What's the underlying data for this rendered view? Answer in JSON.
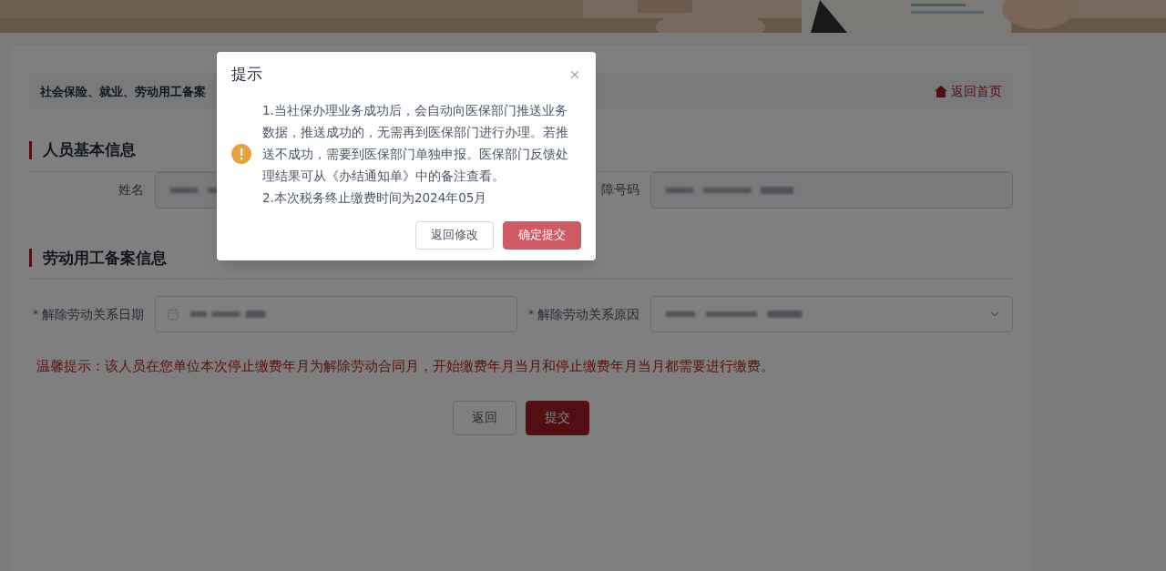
{
  "breadcrumb": {
    "text": "社会保险、就业、劳动用工备案",
    "home_link": "返回首页"
  },
  "sections": [
    {
      "title": "人员基本信息",
      "fields": [
        {
          "kind": "text",
          "label": "姓名"
        },
        {
          "kind": "text",
          "label": "障号码"
        }
      ]
    },
    {
      "title": "劳动用工备案信息",
      "fields": [
        {
          "kind": "date",
          "label": "解除劳动关系日期",
          "required_mark": "*"
        },
        {
          "kind": "select",
          "label": "解除劳动关系原因",
          "required_mark": "*"
        }
      ]
    }
  ],
  "notice": "温馨提示：该人员在您单位本次停止缴费年月为解除劳动合同月，开始缴费年月当月和停止缴费年月当月都需要进行缴费。",
  "buttons": [
    {
      "label": "返回",
      "primary": false
    },
    {
      "label": "提交",
      "primary": true
    }
  ],
  "dialog": {
    "title": "提示",
    "messages": [
      "1.当社保办理业务成功后，会自动向医保部门推送业务数据，推送成功的，无需再到医保部门进行办理。若推送不成功，需要到医保部门单独申报。医保部门反馈处理结果可从《办结通知单》中的备注查看。",
      "2.本次税务终止缴费时间为2024年05月"
    ],
    "buttons": [
      {
        "label": "返回修改",
        "primary": false
      },
      {
        "label": "确定提交",
        "primary": true
      }
    ]
  }
}
